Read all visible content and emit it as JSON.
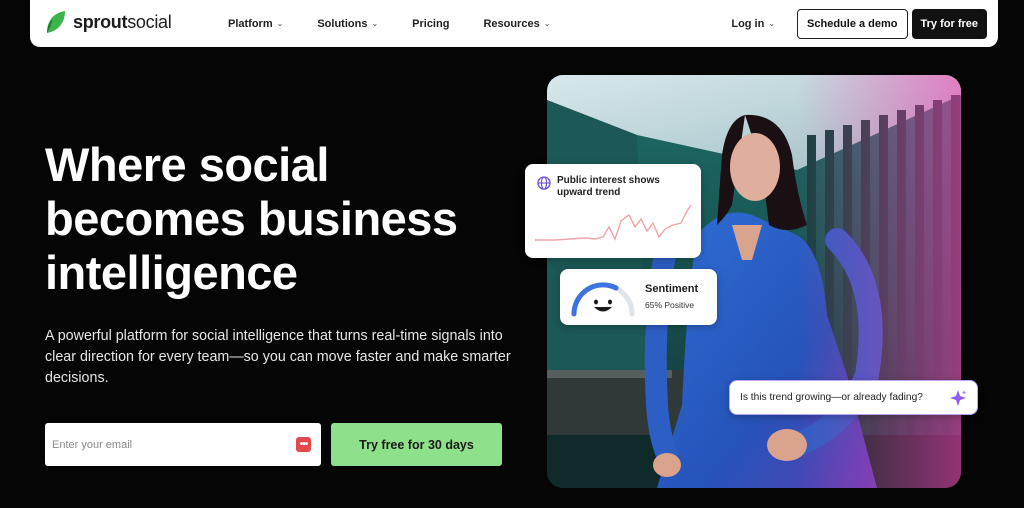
{
  "nav": {
    "brand_first": "sprout",
    "brand_second": "social",
    "items": [
      {
        "label": "Platform",
        "has_menu": true
      },
      {
        "label": "Solutions",
        "has_menu": true
      },
      {
        "label": "Pricing",
        "has_menu": false
      },
      {
        "label": "Resources",
        "has_menu": true
      }
    ],
    "login": "Log in",
    "demo_button": "Schedule a demo",
    "try_button": "Try for free",
    "chevron": "⌄"
  },
  "hero": {
    "title": "Where social becomes business intelligence",
    "subtitle": "A powerful platform for social intelligence that turns real-time signals into clear direction for every team—so you can move faster and make smarter decisions.",
    "email_placeholder": "Enter your email",
    "cta": "Try free for 30 days"
  },
  "cards": {
    "trend": {
      "text": "Public interest shows upward trend",
      "icon": "globe-icon"
    },
    "sentiment": {
      "title": "Sentiment",
      "value": "65% Positive",
      "positive_fraction": 0.65
    },
    "question": {
      "text": "Is this trend growing—or already fading?",
      "icon": "sparkle-icon"
    }
  },
  "colors": {
    "accent_green": "#8fe08a",
    "brand_green": "#3bb54a",
    "trend_line": "#f2a3a8",
    "question_border": "#b9a7f6",
    "background": "#050505"
  }
}
